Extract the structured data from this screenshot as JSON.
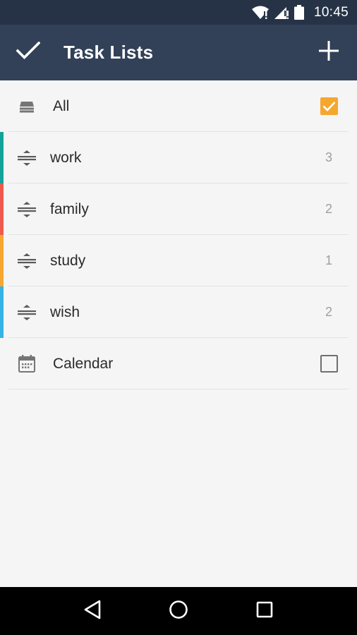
{
  "status_bar": {
    "time": "10:45",
    "icons": [
      "wifi-icon",
      "signal-icon",
      "battery-icon"
    ]
  },
  "app_bar": {
    "title": "Task Lists",
    "left_icon": "check-icon",
    "right_icon": "plus-icon"
  },
  "list": {
    "all": {
      "label": "All",
      "icon": "stack-icon",
      "checked": true
    },
    "items": [
      {
        "label": "work",
        "count": "3",
        "color": "#14a39a",
        "icon": "reorder-icon"
      },
      {
        "label": "family",
        "count": "2",
        "color": "#ef5a4e",
        "icon": "reorder-icon"
      },
      {
        "label": "study",
        "count": "1",
        "color": "#f5a72f",
        "icon": "reorder-icon"
      },
      {
        "label": "wish",
        "count": "2",
        "color": "#34b3e6",
        "icon": "reorder-icon"
      }
    ],
    "calendar": {
      "label": "Calendar",
      "icon": "calendar-icon",
      "checked": false
    }
  },
  "colors": {
    "status_bar": "#263347",
    "app_bar": "#324158",
    "accent": "#f5a72f",
    "background": "#f5f5f5"
  },
  "nav_bar": {
    "icons": [
      "back-icon",
      "home-icon",
      "recents-icon"
    ]
  }
}
